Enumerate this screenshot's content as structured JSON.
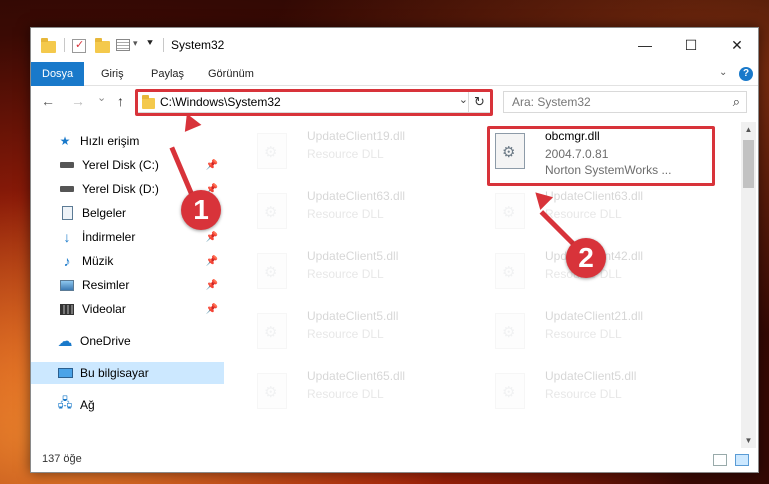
{
  "window": {
    "title": "System32",
    "controls": {
      "minimize": "—",
      "maximize": "☐",
      "close": "✕"
    }
  },
  "ribbon": {
    "tabs": [
      "Dosya",
      "Giriş",
      "Paylaş",
      "Görünüm"
    ],
    "help": "?"
  },
  "nav": {
    "back": "←",
    "forward": "→",
    "recent": "⌄",
    "up": "↑",
    "address": "C:\\Windows\\System32",
    "search_placeholder": "Ara: System32"
  },
  "sidebar": {
    "items": [
      {
        "label": "Hızlı erişim",
        "icon": "star-icon",
        "pinned": false
      },
      {
        "label": "Yerel Disk (C:)",
        "icon": "drive-icon",
        "pinned": true
      },
      {
        "label": "Yerel Disk (D:)",
        "icon": "drive-icon",
        "pinned": true
      },
      {
        "label": "Belgeler",
        "icon": "documents-icon",
        "pinned": true
      },
      {
        "label": "İndirmeler",
        "icon": "download-icon",
        "pinned": true
      },
      {
        "label": "Müzik",
        "icon": "music-icon",
        "pinned": true
      },
      {
        "label": "Resimler",
        "icon": "pictures-icon",
        "pinned": true
      },
      {
        "label": "Videolar",
        "icon": "videos-icon",
        "pinned": true
      },
      {
        "label": "OneDrive",
        "icon": "cloud-icon",
        "pinned": false
      },
      {
        "label": "Bu bilgisayar",
        "icon": "computer-icon",
        "pinned": false
      },
      {
        "label": "Ağ",
        "icon": "network-icon",
        "pinned": false
      }
    ],
    "pin_glyph": "📌"
  },
  "files": {
    "left": [
      {
        "name": "UpdateClient19.dll",
        "desc": "Resource DLL"
      },
      {
        "name": "UpdateClient63.dll",
        "desc": "Resource DLL"
      },
      {
        "name": "UpdateClient5.dll",
        "desc": "Resource DLL"
      },
      {
        "name": "UpdateClient5.dll",
        "desc": "Resource DLL"
      },
      {
        "name": "UpdateClient65.dll",
        "desc": "Resource DLL"
      }
    ],
    "right": [
      {
        "name": "obcmgr.dll",
        "desc": "2004.7.0.81",
        "desc2": "Norton SystemWorks ..."
      },
      {
        "name": "UpdateClient63.dll",
        "desc": "Resource DLL"
      },
      {
        "name": "UpdateClient42.dll",
        "desc": "Resource DLL"
      },
      {
        "name": "UpdateClient21.dll",
        "desc": "Resource DLL"
      },
      {
        "name": "UpdateClient5.dll",
        "desc": "Resource DLL"
      }
    ]
  },
  "status": {
    "count": "137 öğe"
  },
  "annotations": {
    "step1": "1",
    "step2": "2"
  },
  "colors": {
    "accent": "#1979ca",
    "highlight": "#d8333a",
    "selection": "#cce8ff"
  }
}
